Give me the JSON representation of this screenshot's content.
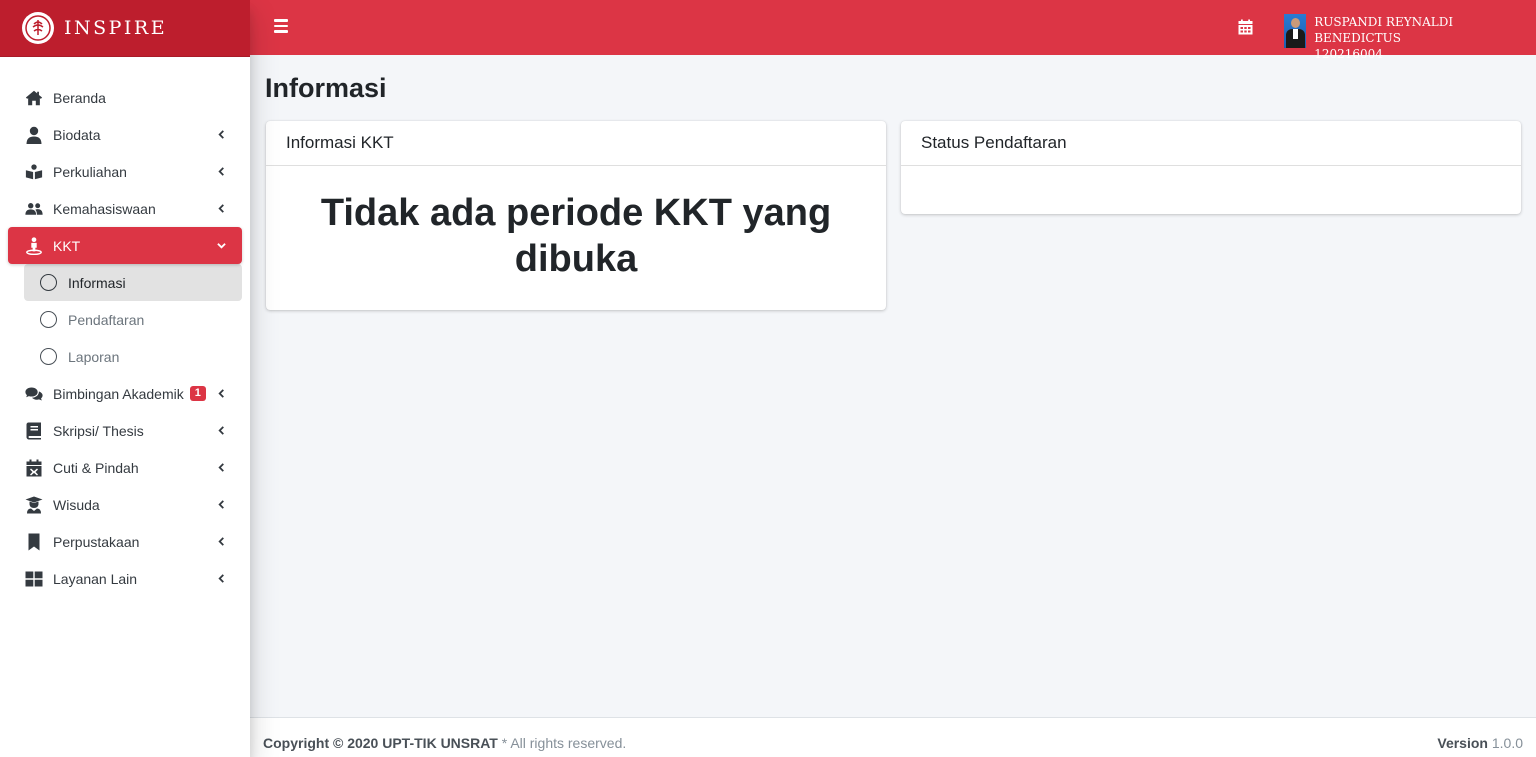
{
  "brand": {
    "name": "INSPIRE"
  },
  "topbar": {
    "user_name": "RUSPANDI REYNALDI BENEDICTUS",
    "user_id": "120216004"
  },
  "sidebar": {
    "items": [
      {
        "label": "Beranda",
        "icon": "home-icon"
      },
      {
        "label": "Biodata",
        "icon": "user-icon"
      },
      {
        "label": "Perkuliahan",
        "icon": "book-reader-icon"
      },
      {
        "label": "Kemahasiswaan",
        "icon": "users-icon"
      },
      {
        "label": "KKT",
        "icon": "street-view-icon"
      },
      {
        "label": "Bimbingan Akademik",
        "icon": "comments-icon",
        "badge": "1"
      },
      {
        "label": "Skripsi/ Thesis",
        "icon": "book-icon"
      },
      {
        "label": "Cuti & Pindah",
        "icon": "calendar-times-icon"
      },
      {
        "label": "Wisuda",
        "icon": "graduate-icon"
      },
      {
        "label": "Perpustakaan",
        "icon": "bookmark-icon"
      },
      {
        "label": "Layanan Lain",
        "icon": "th-large-icon"
      }
    ],
    "kkt_sub": [
      {
        "label": "Informasi"
      },
      {
        "label": "Pendaftaran"
      },
      {
        "label": "Laporan"
      }
    ]
  },
  "main": {
    "page_title": "Informasi",
    "card_kkt": {
      "title": "Informasi KKT",
      "message": "Tidak ada periode KKT yang dibuka"
    },
    "card_status": {
      "title": "Status Pendaftaran"
    }
  },
  "footer": {
    "copyright": "Copyright © 2020 UPT-TIK UNSRAT",
    "rights": " * All rights reserved.",
    "version_label": "Version",
    "version_value": " 1.0.0"
  },
  "colors": {
    "brand_dark": "#bd1e2d",
    "brand": "#dc3545",
    "background": "#f4f6f9"
  }
}
